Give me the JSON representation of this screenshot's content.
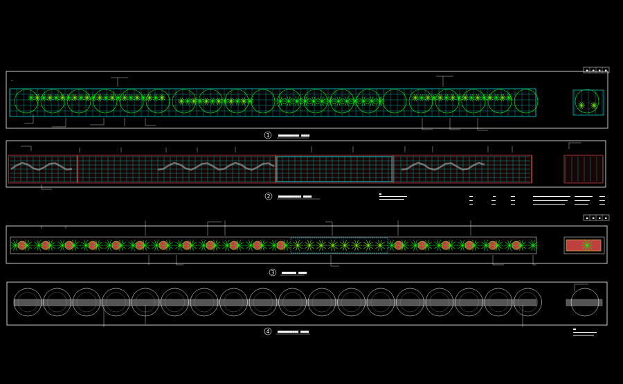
{
  "colors": {
    "background": "#000000",
    "frame": "#ffffff",
    "grid": "#00ffff",
    "plant": "#00ff00",
    "plant_light": "#7fff00",
    "paving": "#c04040",
    "hatch": "#b0b0b0",
    "gold": "#c8a040"
  },
  "panels": [
    {
      "number": "1",
      "caption": "■■■■■■■■■■  ■■■■"
    },
    {
      "number": "2",
      "caption": "■■■■■■■■■■■  ■■■■"
    },
    {
      "number": "3",
      "caption": "■■■■■■■  ■■■■"
    },
    {
      "number": "4",
      "caption": "■■■■■■■■■■  ■■■■"
    }
  ],
  "title_blocks": [
    {
      "cells": [
        "■",
        "■",
        "■",
        "■"
      ]
    },
    {
      "cells": [
        "■",
        "■",
        "■",
        "■"
      ]
    }
  ]
}
